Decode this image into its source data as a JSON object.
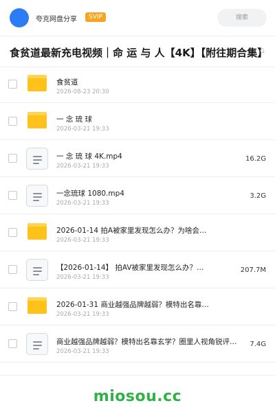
{
  "header": {
    "username": "夸克网盘分享",
    "badge": "SVIP",
    "search_placeholder": "搜索"
  },
  "share": {
    "title": "食贫道最新充电视频｜命 运 与 人【4K】【附往期合集】",
    "title_size": "G"
  },
  "items": [
    {
      "type": "folder",
      "name": "食贫道",
      "date": "2026-08-23 20:30",
      "size": ""
    },
    {
      "type": "folder",
      "name": "一 念 琉 球",
      "date": "2026-03-21 19:33",
      "size": ""
    },
    {
      "type": "file",
      "name": "一 念 琉 球 4K.mp4",
      "date": "2026-03-21 19:33",
      "size": "16.2G"
    },
    {
      "type": "file",
      "name": "一念琉球 1080.mp4",
      "date": "2026-03-21 19:33",
      "size": "3.2G"
    },
    {
      "type": "folder",
      "name": "2026-01-14 拍A被家里发现怎么办？为啥会…",
      "date": "2026-03-21 19:33",
      "size": ""
    },
    {
      "type": "file",
      "name": "【2026-01-14】 拍AV被家里发现怎么办？…",
      "date": "2026-03-21 19:33",
      "size": "207.7M"
    },
    {
      "type": "folder",
      "name": "2026-01-31 商业越强品牌越弱？模特出名靠…",
      "date": "2026-03-21 19:33",
      "size": ""
    },
    {
      "type": "file",
      "name": "商业越强品牌越弱？模特出名靠玄学？圈里人视角锐评时…",
      "date": "2026-03-21 19:33",
      "size": "7.4G"
    }
  ],
  "watermark": "miosou.cc",
  "colors": {
    "avatar": "#2d7cf6",
    "badge": "#f5a524",
    "folder": "#ffc21a",
    "watermark": "#2fb146"
  }
}
